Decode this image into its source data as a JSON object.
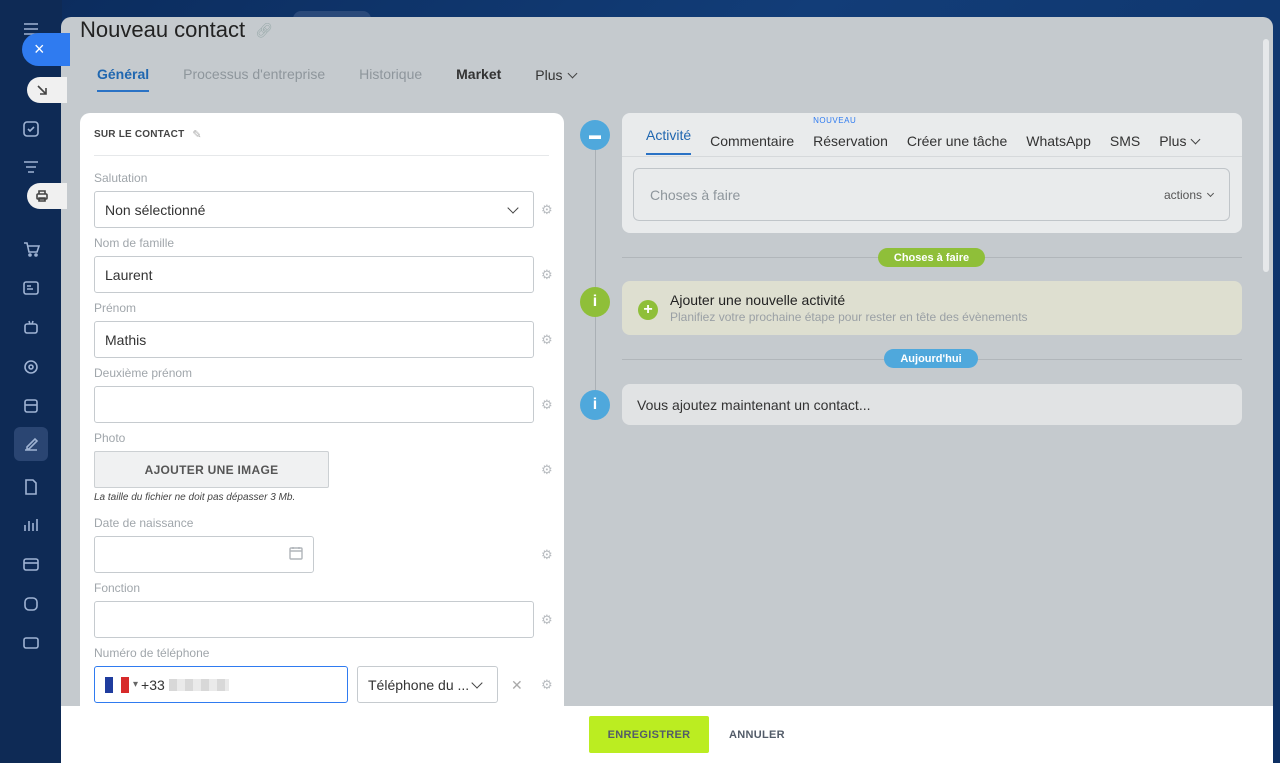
{
  "header": {
    "title": "Nouveau contact"
  },
  "tabs": [
    {
      "label": "Général"
    },
    {
      "label": "Processus d'entreprise"
    },
    {
      "label": "Historique"
    },
    {
      "label": "Market"
    },
    {
      "label": "Plus"
    }
  ],
  "form": {
    "section_title": "SUR LE CONTACT",
    "salutation": {
      "label": "Salutation",
      "value": "Non sélectionné"
    },
    "last_name": {
      "label": "Nom de famille",
      "value": "Laurent"
    },
    "first_name": {
      "label": "Prénom",
      "value": "Mathis"
    },
    "middle_name": {
      "label": "Deuxième prénom",
      "value": ""
    },
    "photo": {
      "label": "Photo",
      "button": "AJOUTER UNE IMAGE",
      "hint": "La taille du fichier ne doit pas dépasser 3 Mb."
    },
    "birth_date": {
      "label": "Date de naissance",
      "value": ""
    },
    "position": {
      "label": "Fonction",
      "value": ""
    },
    "phone": {
      "label": "Numéro de téléphone",
      "prefix": "+33",
      "type": "Téléphone du ..."
    }
  },
  "activity": {
    "tabs": [
      {
        "label": "Activité"
      },
      {
        "label": "Commentaire"
      },
      {
        "label": "Réservation",
        "badge": "NOUVEAU"
      },
      {
        "label": "Créer une tâche"
      },
      {
        "label": "WhatsApp"
      },
      {
        "label": "SMS"
      },
      {
        "label": "Plus"
      }
    ],
    "todo_placeholder": "Choses à faire",
    "todo_actions": "actions"
  },
  "timeline": {
    "badge_todo": "Choses à faire",
    "new_activity_title": "Ajouter une nouvelle activité",
    "new_activity_subtitle": "Planifiez votre prochaine étape pour rester en tête des évènements",
    "badge_today": "Aujourd'hui",
    "info_text": "Vous ajoutez maintenant un contact..."
  },
  "footer": {
    "save": "ENREGISTRER",
    "cancel": "ANNULER"
  },
  "colors": {
    "accent": "#2f7bf0",
    "save_green": "#bbed21",
    "badge_green": "#8fbf39",
    "badge_blue": "#4fa8dc"
  }
}
